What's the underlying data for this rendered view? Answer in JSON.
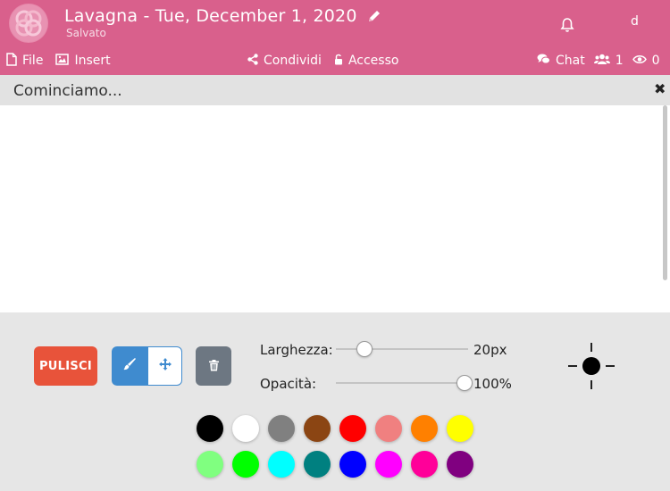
{
  "header": {
    "title": "Lavagna - Tue, December 1, 2020",
    "status": "Salvato",
    "user_initial": "d"
  },
  "menu": {
    "file": "File",
    "insert": "Insert",
    "share": "Condividi",
    "access": "Accesso",
    "chat": "Chat",
    "users_count": "1",
    "viewers_count": "0"
  },
  "board": {
    "title": "Cominciamo..."
  },
  "tools": {
    "clear_label": "PULISCI",
    "width_label": "Larghezza:",
    "width_value": "20px",
    "width_level": 0.2,
    "opacity_label": "Opacità:",
    "opacity_value": "100%",
    "opacity_level": 1.0
  },
  "palette": [
    "#000000",
    "#ffffff",
    "#808080",
    "#8b4513",
    "#ff0000",
    "#f08080",
    "#ff8000",
    "#ffff00",
    "#80ff80",
    "#00ff00",
    "#00ffff",
    "#008080",
    "#0000ff",
    "#ff00ff",
    "#ff0099",
    "#800080"
  ],
  "icons": [
    "logo-icon",
    "pencil-icon",
    "bell-icon",
    "file-icon",
    "image-icon",
    "share-icon",
    "lock-open-icon",
    "chat-icon",
    "users-icon",
    "eye-icon",
    "close-icon",
    "brush-icon",
    "move-icon",
    "trash-icon",
    "crosshair-icon"
  ]
}
